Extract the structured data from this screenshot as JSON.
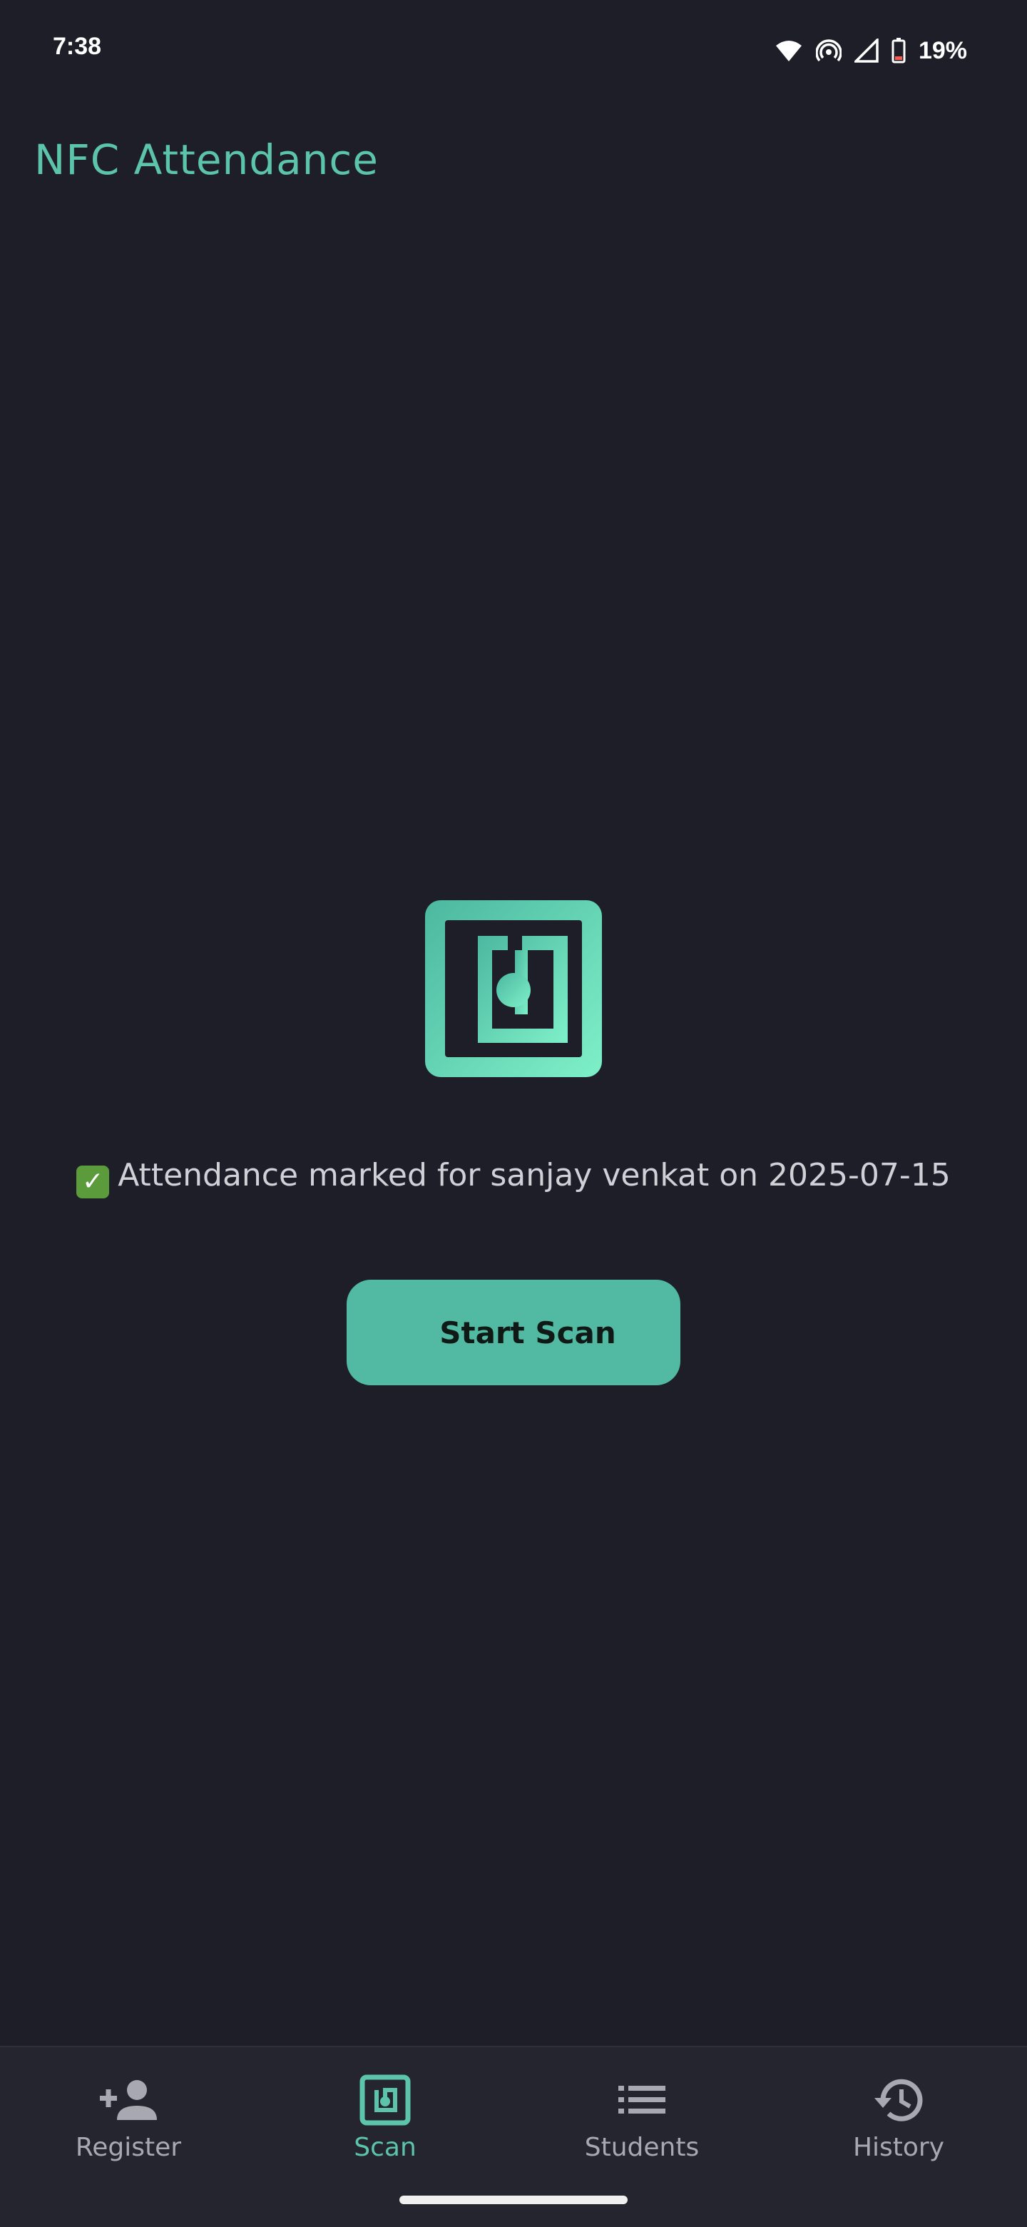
{
  "status_bar": {
    "time": "7:38",
    "battery": "19%"
  },
  "app": {
    "title": "NFC Attendance"
  },
  "main": {
    "status_message": "Attendance marked for sanjay venkat on 2025-07-15",
    "start_scan_label": "Start Scan"
  },
  "bottom_nav": {
    "items": [
      {
        "label": "Register",
        "icon": "person-add-icon"
      },
      {
        "label": "Scan",
        "icon": "nfc-icon",
        "active": true
      },
      {
        "label": "Students",
        "icon": "list-icon"
      },
      {
        "label": "History",
        "icon": "history-icon"
      }
    ]
  },
  "colors": {
    "accent": "#5bc4a9",
    "background": "#1e1e29",
    "nav_background": "#252530",
    "button": "#52baa3"
  }
}
